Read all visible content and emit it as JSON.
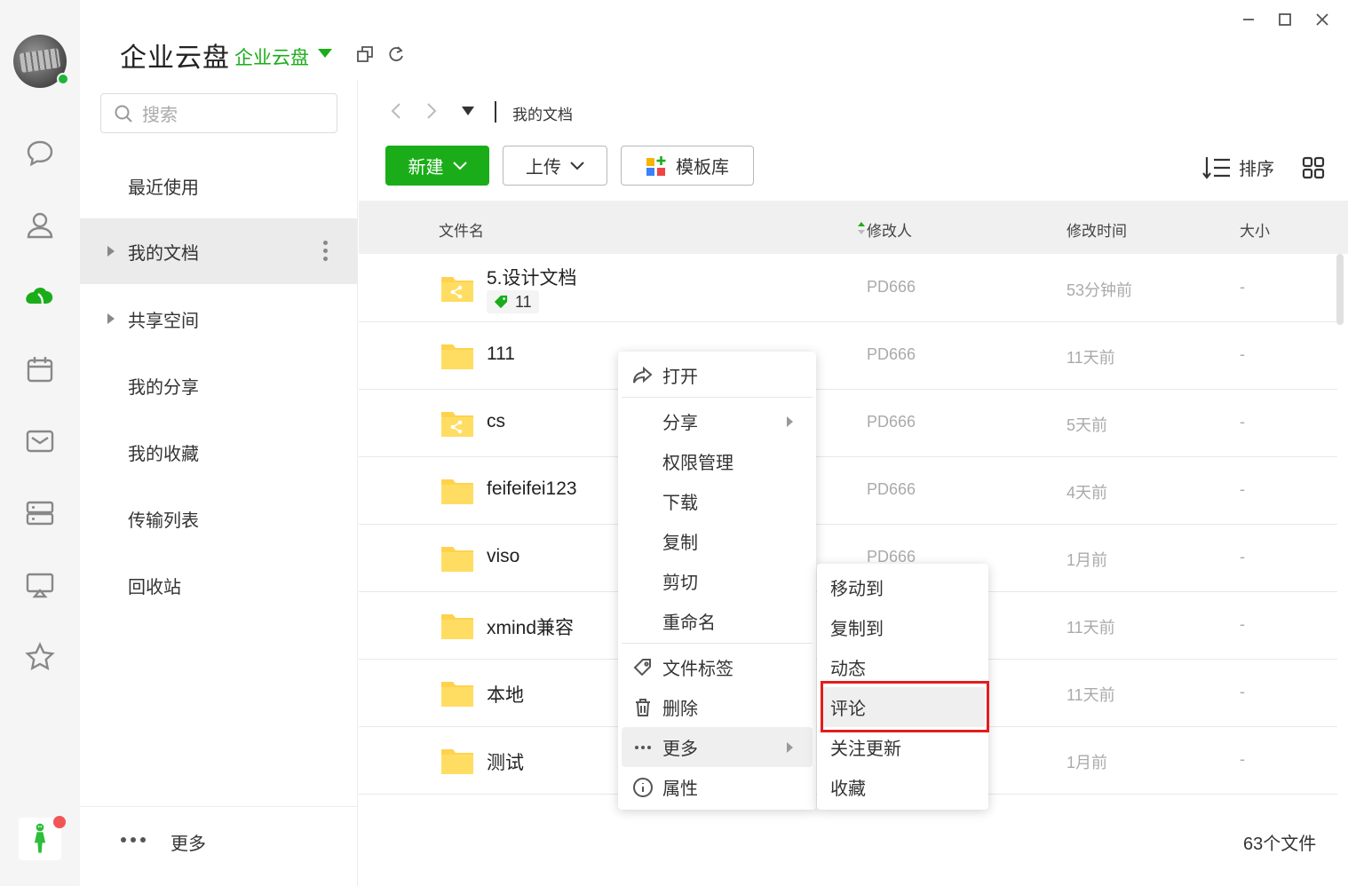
{
  "app": {
    "title": "企业云盘",
    "space_name": "企业云盘",
    "colors": {
      "brand_green": "#1aad19",
      "highlight_red": "#e21d1d",
      "folder_yellow": "#ffd24d"
    }
  },
  "rail": {
    "icons": [
      "chat-icon",
      "contacts-icon",
      "cloud-disk-icon",
      "calendar-icon",
      "mail-icon",
      "storage-icon",
      "screen-share-icon",
      "star-icon"
    ]
  },
  "search": {
    "placeholder": "搜索"
  },
  "sidebar": {
    "items": [
      {
        "label": "最近使用"
      },
      {
        "label": "我的文档"
      },
      {
        "label": "共享空间"
      },
      {
        "label": "我的分享"
      },
      {
        "label": "我的收藏"
      },
      {
        "label": "传输列表"
      },
      {
        "label": "回收站"
      }
    ],
    "more_label": "更多"
  },
  "breadcrumb": {
    "current": "我的文档"
  },
  "toolbar": {
    "new_label": "新建",
    "upload_label": "上传",
    "template_label": "模板库",
    "sort_label": "排序"
  },
  "table": {
    "headers": {
      "name": "文件名",
      "modifier": "修改人",
      "mtime": "修改时间",
      "size": "大小"
    },
    "rows": [
      {
        "name": "5.设计文档",
        "modifier": "PD666",
        "mtime": "53分钟前",
        "size": "-",
        "shared": true,
        "tag_count": "11"
      },
      {
        "name": "111",
        "modifier": "PD666",
        "mtime": "11天前",
        "size": "-",
        "shared": false
      },
      {
        "name": "cs",
        "modifier": "PD666",
        "mtime": "5天前",
        "size": "-",
        "shared": true
      },
      {
        "name": "feifeifei123",
        "modifier": "PD666",
        "mtime": "4天前",
        "size": "-",
        "shared": false
      },
      {
        "name": "viso",
        "modifier": "PD666",
        "mtime": "1月前",
        "size": "-",
        "shared": false
      },
      {
        "name": "xmind兼容",
        "modifier": "",
        "mtime": "11天前",
        "size": "-",
        "shared": false
      },
      {
        "name": "本地",
        "modifier": "",
        "mtime": "11天前",
        "size": "-",
        "shared": false
      },
      {
        "name": "测试",
        "modifier": "",
        "mtime": "1月前",
        "size": "-",
        "shared": false
      }
    ],
    "file_count": "63个文件"
  },
  "context_menu": {
    "open": "打开",
    "share": "分享",
    "permissions": "权限管理",
    "download": "下载",
    "copy": "复制",
    "cut": "剪切",
    "rename": "重命名",
    "file_tags": "文件标签",
    "delete": "删除",
    "more": "更多",
    "properties": "属性"
  },
  "submenu": {
    "move_to": "移动到",
    "copy_to": "复制到",
    "activity": "动态",
    "comment": "评论",
    "follow_updates": "关注更新",
    "favorite": "收藏"
  }
}
